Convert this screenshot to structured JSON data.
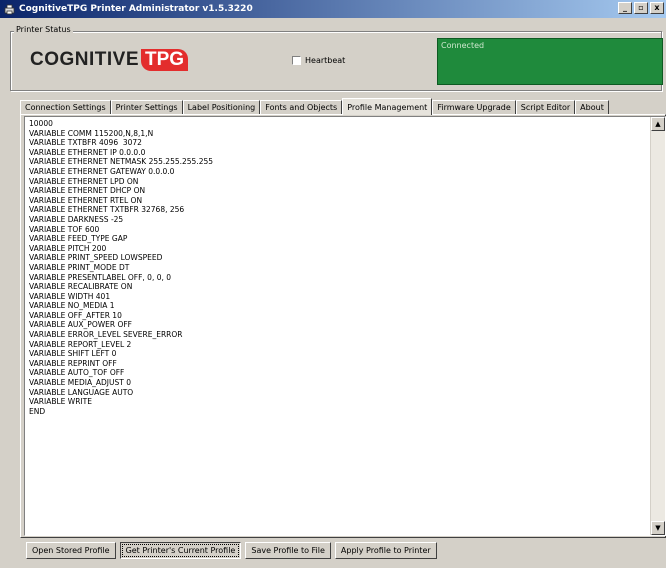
{
  "window": {
    "title": "CognitiveTPG Printer Administrator v1.5.3220",
    "minimize_glyph": "_",
    "restore_glyph": "▫",
    "close_glyph": "x"
  },
  "status": {
    "group_label": "Printer Status",
    "logo_main": "COGNITIVE",
    "logo_accent": "TPG",
    "heartbeat_label": "Heartbeat",
    "heartbeat_checked": false,
    "connection_text": "Connected",
    "connection_color": "#1f8a3c"
  },
  "tabs": [
    {
      "label": "Connection Settings"
    },
    {
      "label": "Printer Settings"
    },
    {
      "label": "Label Positioning"
    },
    {
      "label": "Fonts and Objects"
    },
    {
      "label": "Profile Management"
    },
    {
      "label": "Firmware Upgrade"
    },
    {
      "label": "Script Editor"
    },
    {
      "label": "About"
    }
  ],
  "active_tab": "Profile Management",
  "profile_lines": [
    "10000",
    "VARIABLE COMM 115200,N,8,1,N",
    "VARIABLE TXTBFR 4096  3072",
    "VARIABLE ETHERNET IP 0.0.0.0",
    "VARIABLE ETHERNET NETMASK 255.255.255.255",
    "VARIABLE ETHERNET GATEWAY 0.0.0.0",
    "VARIABLE ETHERNET LPD ON",
    "VARIABLE ETHERNET DHCP ON",
    "VARIABLE ETHERNET RTEL ON",
    "VARIABLE ETHERNET TXTBFR 32768, 256",
    "VARIABLE DARKNESS -25",
    "VARIABLE TOF 600",
    "VARIABLE FEED_TYPE GAP",
    "VARIABLE PITCH 200",
    "VARIABLE PRINT_SPEED LOWSPEED",
    "VARIABLE PRINT_MODE DT",
    "VARIABLE PRESENTLABEL OFF, 0, 0, 0",
    "VARIABLE RECALIBRATE ON",
    "VARIABLE WIDTH 401",
    "VARIABLE NO_MEDIA 1",
    "VARIABLE OFF_AFTER 10",
    "VARIABLE AUX_POWER OFF",
    "VARIABLE ERROR_LEVEL SEVERE_ERROR",
    "VARIABLE REPORT_LEVEL 2",
    "VARIABLE SHIFT LEFT 0",
    "VARIABLE REPRINT OFF",
    "VARIABLE AUTO_TOF OFF",
    "VARIABLE MEDIA_ADJUST 0",
    "VARIABLE LANGUAGE AUTO",
    "VARIABLE WRITE",
    "END"
  ],
  "buttons": {
    "open": "Open Stored Profile",
    "get_current": "Get Printer's Current Profile",
    "save": "Save Profile to File",
    "apply": "Apply Profile to Printer"
  },
  "scroll": {
    "up_glyph": "▲",
    "down_glyph": "▼"
  }
}
